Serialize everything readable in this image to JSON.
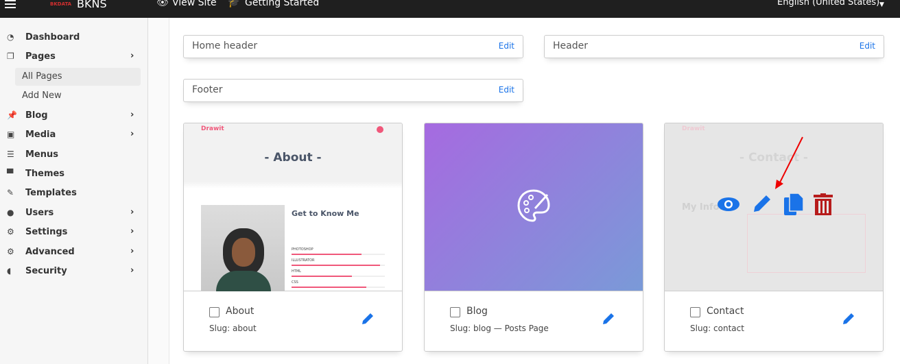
{
  "topbar": {
    "brand_logo": "BKDATA",
    "brand": "BKNS",
    "view_site": "View Site",
    "getting_started": "Getting Started",
    "language": "English (United States)"
  },
  "sidebar": {
    "items": [
      {
        "label": "Dashboard",
        "icon": "dashboard-icon",
        "chevron": false
      },
      {
        "label": "Pages",
        "icon": "pages-icon",
        "chevron": true
      },
      {
        "label": "Blog",
        "icon": "pin-icon",
        "chevron": true
      },
      {
        "label": "Media",
        "icon": "media-icon",
        "chevron": true
      },
      {
        "label": "Menus",
        "icon": "list-icon",
        "chevron": false
      },
      {
        "label": "Themes",
        "icon": "paint-roller-icon",
        "chevron": false
      },
      {
        "label": "Templates",
        "icon": "brush-icon",
        "chevron": false
      },
      {
        "label": "Users",
        "icon": "user-icon",
        "chevron": true
      },
      {
        "label": "Settings",
        "icon": "cogs-icon",
        "chevron": true
      },
      {
        "label": "Advanced",
        "icon": "gear-icon",
        "chevron": true
      },
      {
        "label": "Security",
        "icon": "shield-icon",
        "chevron": true
      }
    ],
    "pages_sub": [
      "All Pages",
      "Add New"
    ]
  },
  "partials": [
    {
      "name": "Home header",
      "edit": "Edit"
    },
    {
      "name": "Header",
      "edit": "Edit"
    },
    {
      "name": "Footer",
      "edit": "Edit"
    }
  ],
  "pages": [
    {
      "title": "About",
      "slug": "Slug: about",
      "thumb": {
        "logo": "Drawit",
        "heading": "- About -",
        "subheading": "Get to Know Me",
        "skills": [
          "PHOTOSHOP",
          "ILLUSTRATOR",
          "HTML",
          "CSS"
        ]
      }
    },
    {
      "title": "Blog",
      "slug": "Slug: blog — Posts Page"
    },
    {
      "title": "Contact",
      "slug": "Slug: contact",
      "thumb": {
        "logo": "Drawit",
        "heading": "- Contact -",
        "subheading": "My Info."
      }
    }
  ],
  "colors": {
    "accent": "#1a73e8",
    "delete": "#b71c1c",
    "brand_pink": "#f0577a"
  }
}
